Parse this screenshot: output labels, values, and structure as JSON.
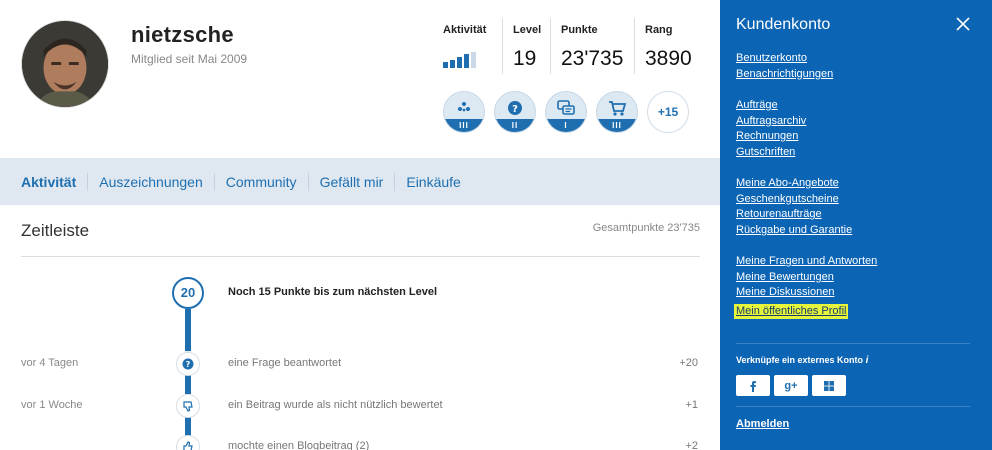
{
  "profile": {
    "username": "nietzsche",
    "member_since": "Mitglied seit Mai 2009"
  },
  "stats": {
    "activity_label": "Aktivität",
    "activity_level": 4,
    "activity_max": 5,
    "level_label": "Level",
    "level_value": "19",
    "points_label": "Punkte",
    "points_value": "23'735",
    "rank_label": "Rang",
    "rank_value": "3890"
  },
  "badges": [
    {
      "icon": "star-cluster-icon",
      "tier": "III"
    },
    {
      "icon": "question-icon",
      "tier": "II"
    },
    {
      "icon": "speech-bubbles-icon",
      "tier": "I"
    },
    {
      "icon": "shopping-cart-icon",
      "tier": "III"
    }
  ],
  "badges_more": "+15",
  "tabs": [
    "Aktivität",
    "Auszeichnungen",
    "Community",
    "Gefällt mir",
    "Einkäufe"
  ],
  "timeline": {
    "title": "Zeitleiste",
    "total_points": "Gesamtpunkte 23'735",
    "level_number": "20",
    "next_level_text": "Noch 15 Punkte bis zum nächsten Level",
    "entries": [
      {
        "time": "vor 4 Tagen",
        "icon": "question-icon",
        "text": "eine Frage beantwortet",
        "points": "+20"
      },
      {
        "time": "vor 1 Woche",
        "icon": "thumbs-down-icon",
        "text": "ein Beitrag wurde als nicht nützlich bewertet",
        "points": "+1"
      },
      {
        "time": "",
        "icon": "thumbs-up-icon",
        "text": "mochte einen Blogbeitrag (2)",
        "points": "+2"
      }
    ]
  },
  "panel": {
    "title": "Kundenkonto",
    "groups": [
      [
        "Benutzerkonto",
        "Benachrichtigungen"
      ],
      [
        "Aufträge",
        "Auftragsarchiv",
        "Rechnungen",
        "Gutschriften"
      ],
      [
        "Meine Abo-Angebote",
        "Geschenkgutscheine",
        "Retourenaufträge",
        "Rückgabe und Garantie"
      ],
      [
        "Meine Fragen und Antworten",
        "Meine Bewertungen",
        "Meine Diskussionen",
        "Mein öffentliches Profil"
      ]
    ],
    "highlighted_link": "Mein öffentliches Profil",
    "connect_label": "Verknüpfe ein externes Konto",
    "connect_info": "i",
    "social": [
      {
        "name": "facebook-icon"
      },
      {
        "name": "google-plus-icon",
        "text": "g+"
      },
      {
        "name": "windows-icon"
      }
    ],
    "logout": "Abmelden"
  },
  "colors": {
    "accent": "#1f6fb0",
    "panel_bg": "#0b64b4",
    "tab_bar_bg": "#dfe8f0",
    "highlight": "#e6f53b"
  }
}
